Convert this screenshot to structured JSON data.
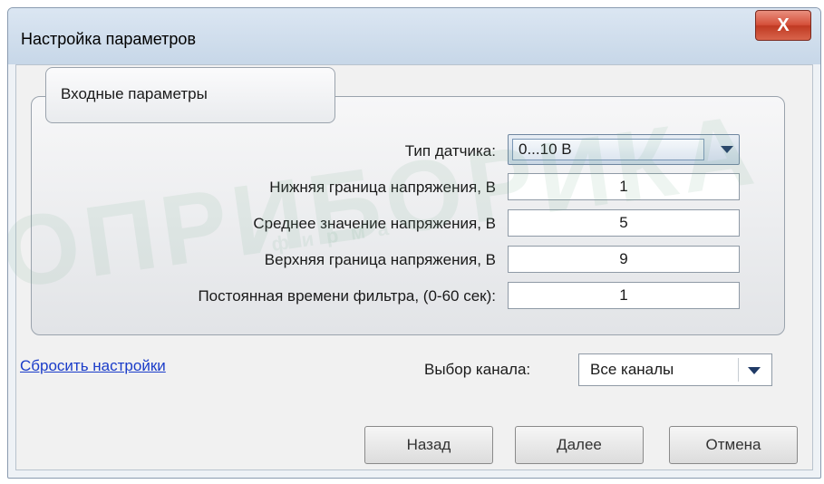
{
  "window": {
    "title": "Настройка параметров",
    "close_label": "X"
  },
  "group": {
    "title": "Входные параметры"
  },
  "fields": {
    "sensor_type": {
      "label": "Тип датчика:",
      "value": "0...10 В"
    },
    "low_voltage": {
      "label": "Нижняя граница напряжения, В",
      "value": "1"
    },
    "mid_voltage": {
      "label": "Среднее значение напряжения, В",
      "value": "5"
    },
    "high_voltage": {
      "label": "Верхняя граница напряжения, В",
      "value": "9"
    },
    "filter_time": {
      "label": "Постоянная времени фильтра, (0-60 сек):",
      "value": "1"
    }
  },
  "reset_link": "Сбросить настройки",
  "channel": {
    "label": "Выбор канала:",
    "value": "Все каналы"
  },
  "buttons": {
    "back": "Назад",
    "next": "Далее",
    "cancel": "Отмена"
  },
  "watermark": {
    "brand": "ОПРИБОРИКА",
    "sub": "фирма"
  },
  "colors": {
    "link": "#1a3cc9",
    "close_button": "#d5503a",
    "titlebar": "#c7d7e8"
  }
}
